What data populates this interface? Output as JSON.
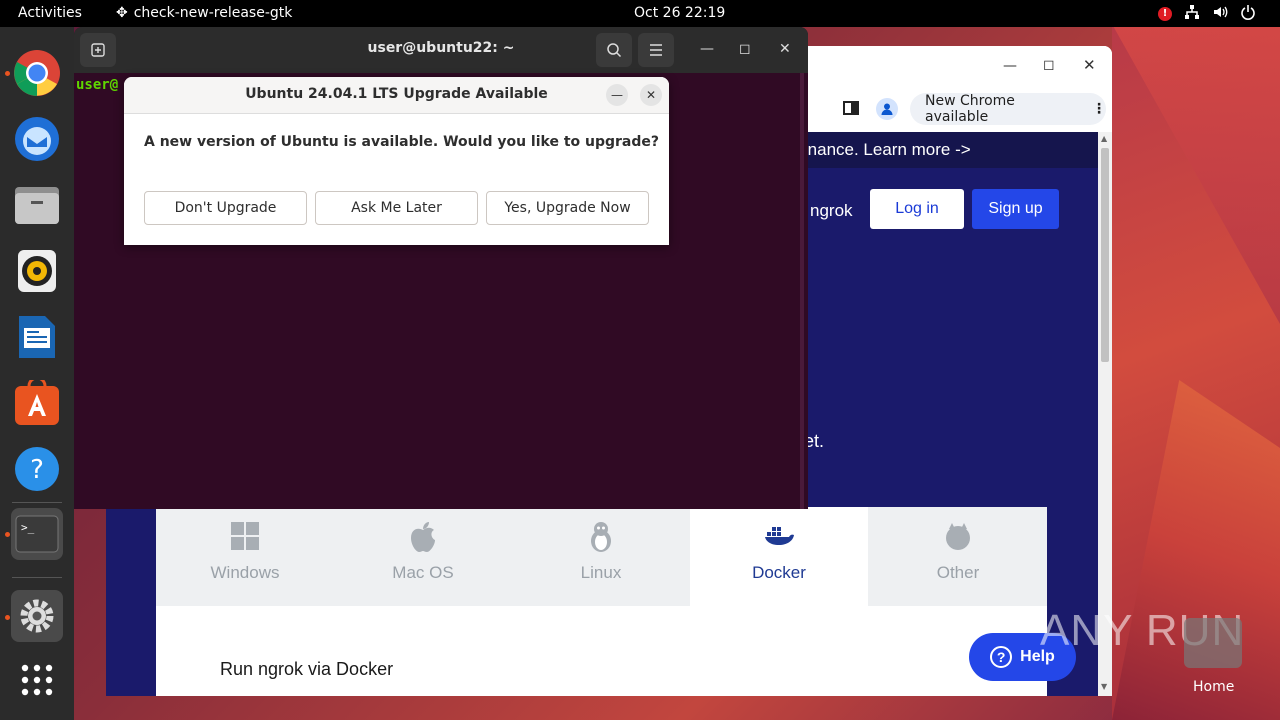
{
  "topbar": {
    "activities": "Activities",
    "app_name": "check-new-release-gtk",
    "clock": "Oct 26  22:19",
    "alert": "!"
  },
  "dock": {
    "items": [
      "chrome-icon",
      "thunderbird-icon",
      "files-icon",
      "rhythmbox-icon",
      "libreoffice-writer-icon",
      "app-center-icon",
      "help-icon",
      "terminal-icon",
      "settings-icon",
      "show-apps-icon"
    ]
  },
  "chrome": {
    "new_chrome_label": "New Chrome available",
    "banner": "rnance. Learn more ->",
    "ngrok_link": "ngrok",
    "login": "Log in",
    "signup": "Sign up",
    "hero_fragment": "et.",
    "os_tabs": [
      {
        "label": "Windows",
        "icon": "windows-icon"
      },
      {
        "label": "Mac OS",
        "icon": "apple-icon"
      },
      {
        "label": "Linux",
        "icon": "linux-icon"
      },
      {
        "label": "Docker",
        "icon": "docker-icon"
      },
      {
        "label": "Other",
        "icon": "other-icon"
      }
    ],
    "docker_title": "Run ngrok via Docker",
    "help": "Help"
  },
  "terminal": {
    "title": "user@ubuntu22: ~",
    "prompt": "user@"
  },
  "dialog": {
    "title": "Ubuntu 24.04.1 LTS Upgrade Available",
    "message": "A new version of Ubuntu is available. Would you like to upgrade?",
    "btn_dont": "Don't Upgrade",
    "btn_later": "Ask Me Later",
    "btn_now": "Yes, Upgrade Now"
  },
  "desktop": {
    "watermark": "ANY RUN",
    "home_label": "Home"
  }
}
